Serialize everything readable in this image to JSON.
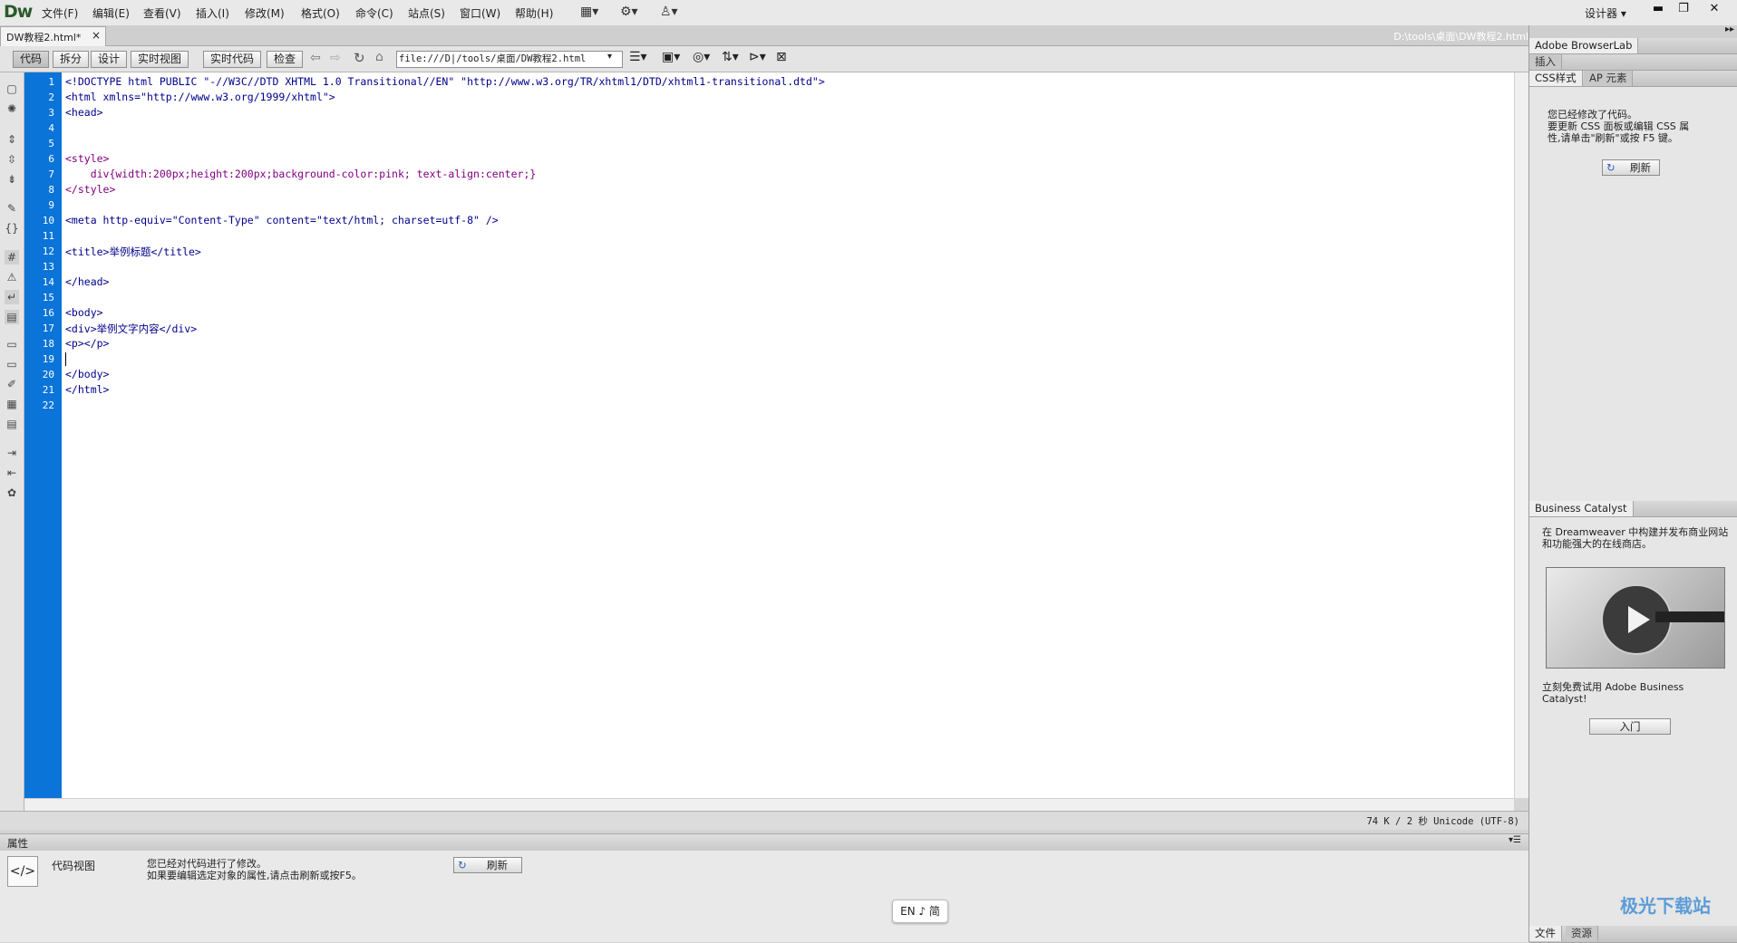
{
  "app": {
    "logo": "Dw",
    "workspace": "设计器 ▾"
  },
  "menu": [
    "文件(F)",
    "编辑(E)",
    "查看(V)",
    "插入(I)",
    "修改(M)",
    "格式(O)",
    "命令(C)",
    "站点(S)",
    "窗口(W)",
    "帮助(H)"
  ],
  "toolbar_icons": [
    "layout-icon",
    "gear-icon",
    "site-icon"
  ],
  "document": {
    "tab_label": "DW教程2.html*",
    "tab_close": "×",
    "path": "D:\\tools\\桌面\\DW教程2.html"
  },
  "doc_toolbar": {
    "views": [
      "代码",
      "拆分",
      "设计",
      "实时视图"
    ],
    "live_code": "实时代码",
    "inspect": "检查",
    "address": "file:///D|/tools/桌面/DW教程2.html"
  },
  "code_lines": [
    "<!DOCTYPE html PUBLIC \"-//W3C//DTD XHTML 1.0 Transitional//EN\" \"http://www.w3.org/TR/xhtml1/DTD/xhtml1-transitional.dtd\">",
    "<html xmlns=\"http://www.w3.org/1999/xhtml\">",
    "<head>",
    "",
    "",
    "<style>",
    "    div{width:200px;height:200px;background-color:pink; text-align:center;}",
    "</style>",
    "",
    "<meta http-equiv=\"Content-Type\" content=\"text/html; charset=utf-8\" />",
    "",
    "<title>举例标题</title>",
    "",
    "</head>",
    "",
    "<body>",
    "<div>举例文字内容</div>",
    "<p></p>",
    "",
    "</body>",
    "</html>",
    ""
  ],
  "status": {
    "info": "74 K / 2 秒  Unicode (UTF-8)"
  },
  "properties": {
    "header": "属性",
    "view_label": "代码视图",
    "message_line1": "您已经对代码进行了修改。",
    "message_line2": "如果要编辑选定对象的属性,请点击刷新或按F5。",
    "refresh": "刷新"
  },
  "right_panel": {
    "browserlab": "Adobe BrowserLab",
    "insert": "插入",
    "css_tab": "CSS样式",
    "ap_tab": "AP 元素",
    "css_msg_1": "您已经修改了代码。",
    "css_msg_2": "要更新 CSS 面板或编辑 CSS 属",
    "css_msg_3": "性,请单击\"刷新\"或按 F5 键。",
    "css_refresh": "刷新",
    "bc_header": "Business Catalyst",
    "bc_text_1": "在 Dreamweaver 中构建并发布商业网站",
    "bc_text_2": "和功能强大的在线商店。",
    "bc_try_1": "立刻免费试用 Adobe Business",
    "bc_try_2": "Catalyst!",
    "bc_button": "入门",
    "files_tab": "文件",
    "assets_tab": "资源"
  },
  "ime": "EN ♪ 简",
  "watermark": "极光下载站"
}
